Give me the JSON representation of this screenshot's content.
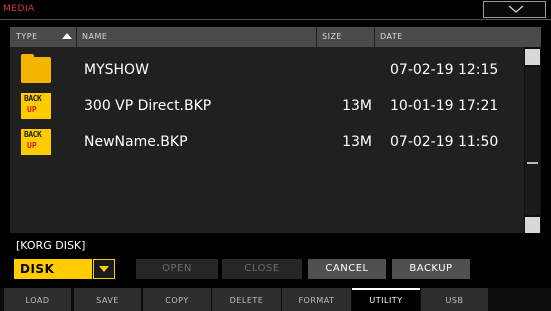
{
  "window": {
    "title": "MEDIA",
    "menu_icon": "chevron-down-icon"
  },
  "columns": {
    "type": "TYPE",
    "name": "NAME",
    "size": "SIZE",
    "date": "DATE",
    "sort": "ascending-by-type"
  },
  "files": [
    {
      "icon": "folder-icon",
      "name": "MYSHOW",
      "size": "",
      "date": "07-02-19 12:15"
    },
    {
      "icon": "backup-icon",
      "icon_top": "BACK",
      "icon_bottom": "UP",
      "name": "300 VP Direct.BKP",
      "size": "13M",
      "date": "10-01-19 17:21"
    },
    {
      "icon": "backup-icon",
      "icon_top": "BACK",
      "icon_bottom": "UP",
      "name": "NewName.BKP",
      "size": "13M",
      "date": "07-02-19 11:50"
    }
  ],
  "current_path": "[KORG DISK]",
  "device": {
    "selected": "DISK"
  },
  "actions": {
    "open": "OPEN",
    "close": "CLOSE",
    "cancel": "CANCEL",
    "backup": "BACKUP"
  },
  "tabs": [
    {
      "label": "LOAD",
      "active": false
    },
    {
      "label": "SAVE",
      "active": false
    },
    {
      "label": "COPY",
      "active": false
    },
    {
      "label": "DELETE",
      "active": false
    },
    {
      "label": "FORMAT",
      "active": false
    },
    {
      "label": "UTILITY",
      "active": true
    },
    {
      "label": "USB",
      "active": false
    }
  ],
  "colors": {
    "title": "#e03a3a",
    "accent": "#ffcc00",
    "folder": "#f4b400"
  }
}
